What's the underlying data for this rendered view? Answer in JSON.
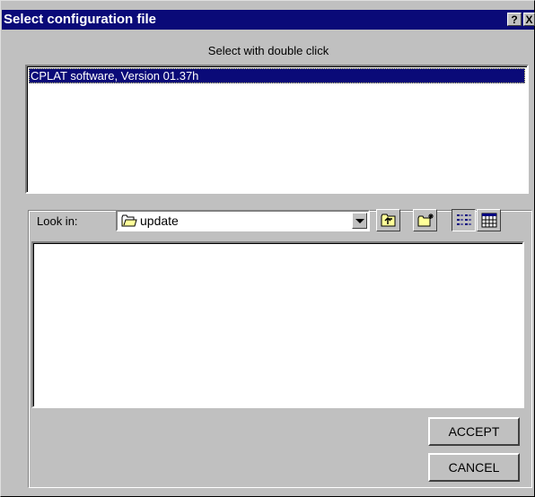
{
  "window": {
    "title": "Select configuration file",
    "help_label": "?",
    "close_label": "X"
  },
  "hint": "Select with double click",
  "file_list": {
    "items": [
      {
        "label": "CPLAT software, Version 01.37h",
        "selected": true
      }
    ]
  },
  "browser": {
    "look_in_label": "Look in:",
    "current_folder": "update",
    "toolbar": {
      "up_icon": "up-one-level-icon",
      "new_folder_icon": "new-folder-icon",
      "list_view_icon": "list-view-icon",
      "details_view_icon": "details-view-icon"
    }
  },
  "buttons": {
    "accept_label": "ACCEPT",
    "cancel_label": "CANCEL"
  },
  "colors": {
    "titlebar": "#0a0a78",
    "selection": "#0a0a78",
    "face": "#c0c0c0"
  }
}
